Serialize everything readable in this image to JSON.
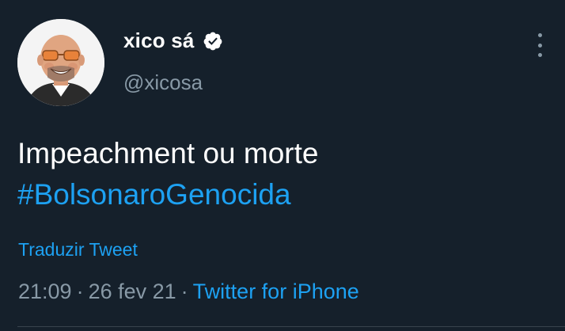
{
  "tweet": {
    "author": {
      "display_name": "xico sá",
      "handle": "@xicosa",
      "verified": true,
      "avatar_icon": "profile-photo-avatar"
    },
    "text_line1": "Impeachment ou morte",
    "hashtag": "#BolsonaroGenocida",
    "translate_label": "Traduzir Tweet",
    "meta": {
      "time": "21:09",
      "separator": "·",
      "date": "26 fev 21",
      "source": "Twitter for iPhone"
    },
    "more_icon": "more-vertical-icon"
  },
  "colors": {
    "background": "#15202b",
    "text": "#ffffff",
    "secondary": "#8899a6",
    "accent": "#1da1f2",
    "divider": "#38444d"
  }
}
